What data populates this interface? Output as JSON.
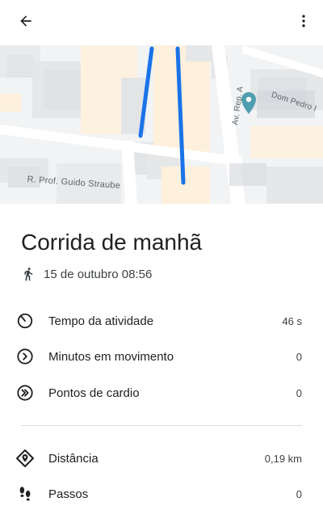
{
  "header": {
    "back_icon": "arrow-back-icon",
    "more_icon": "more-vert-icon"
  },
  "map": {
    "streets": {
      "guido_straube": "R. Prof. Guido Straube",
      "av_rep": "Av. Rep. A",
      "dom_pedro": "Dom Pedro I"
    },
    "route_color": "#1a73e8",
    "pin_color": "#4f9fb0"
  },
  "activity": {
    "title": "Corrida de manhã",
    "type_icon": "running-icon",
    "datetime": "15 de outubro 08:56"
  },
  "metrics": [
    {
      "icon": "timer-icon",
      "label": "Tempo da atividade",
      "value": "46 s"
    },
    {
      "icon": "move-minutes-icon",
      "label": "Minutos em movimento",
      "value": "0"
    },
    {
      "icon": "heart-points-icon",
      "label": "Pontos de cardio",
      "value": "0"
    }
  ],
  "details": [
    {
      "icon": "distance-icon",
      "label": "Distância",
      "value": "0,19 km"
    },
    {
      "icon": "steps-icon",
      "label": "Passos",
      "value": "0"
    }
  ]
}
